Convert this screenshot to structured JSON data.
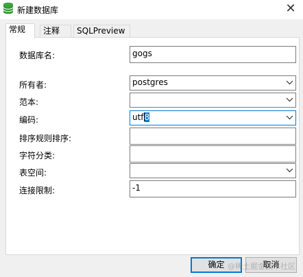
{
  "window": {
    "title": "新建数据库",
    "icon": "database-icon",
    "close_icon": "close-icon"
  },
  "tabs": [
    {
      "label": "常规",
      "active": true
    },
    {
      "label": "注释",
      "active": false
    },
    {
      "label": "SQLPreview",
      "active": false
    }
  ],
  "form": {
    "db_name": {
      "label": "数据库名:",
      "value": "gogs"
    },
    "owner": {
      "label": "所有者:",
      "value": "postgres"
    },
    "template": {
      "label": "范本:",
      "value": ""
    },
    "encoding": {
      "label": "编码:",
      "value_before": "utf",
      "value_selected": "8"
    },
    "collation": {
      "label": "排序规则排序:",
      "value": ""
    },
    "ctype": {
      "label": "字符分类:",
      "value": ""
    },
    "tablespace": {
      "label": "表空间:",
      "value": ""
    },
    "conn_limit": {
      "label": "连接限制:",
      "value": "-1"
    }
  },
  "buttons": {
    "ok": "确定",
    "cancel": "取消"
  },
  "watermark": "@稀土掘金技术社区",
  "colors": {
    "accent": "#0078d7",
    "selection": "#0078d7"
  }
}
